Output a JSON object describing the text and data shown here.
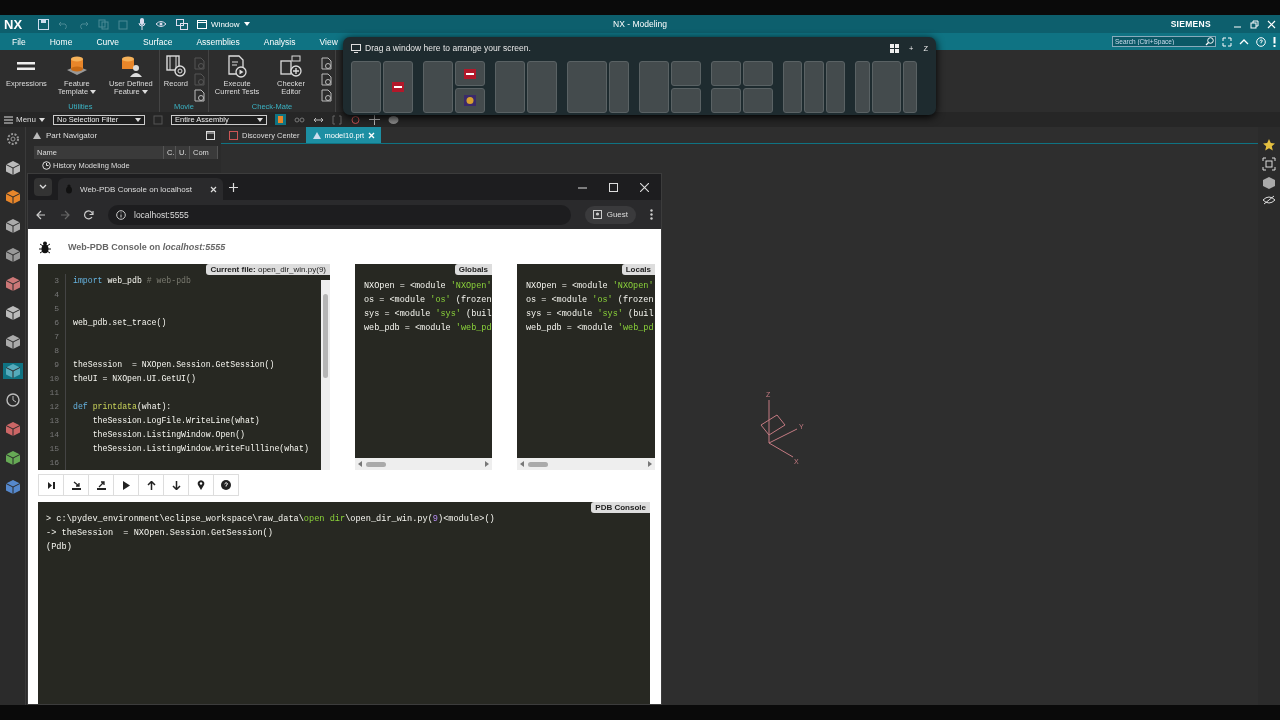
{
  "nx": {
    "logo": "NX",
    "window_menu": "Window",
    "title": "NX - Modeling",
    "brand": "SIEMENS",
    "menu_tabs": [
      {
        "label": "File",
        "selected": false
      },
      {
        "label": "Home",
        "selected": false
      },
      {
        "label": "Curve",
        "selected": false
      },
      {
        "label": "Surface",
        "selected": false
      },
      {
        "label": "Assemblies",
        "selected": false
      },
      {
        "label": "Analysis",
        "selected": false
      },
      {
        "label": "View",
        "selected": false
      }
    ],
    "search": {
      "placeholder": "Search (Ctrl+Space)"
    },
    "ribbon": [
      {
        "label": "Utilities",
        "tools": [
          {
            "label": "Expressions",
            "kind": "equals",
            "has_menu": false
          },
          {
            "label": "Feature Template",
            "kind": "template",
            "has_menu": true
          },
          {
            "label": "User Defined Feature",
            "kind": "udf",
            "has_menu": true
          }
        ]
      },
      {
        "label": "Movie",
        "tools": [
          {
            "label": "Record",
            "kind": "film",
            "has_menu": false
          }
        ]
      },
      {
        "label": "Check-Mate",
        "tools": [
          {
            "label": "Execute Current Tests",
            "kind": "run",
            "has_menu": false
          },
          {
            "label": "Checker Editor",
            "kind": "checker",
            "has_menu": false
          }
        ]
      }
    ],
    "toolbar": {
      "menu": "Menu",
      "selection_filter": "No Selection Filter",
      "assembly_scope": "Entire Assembly"
    },
    "resource_bar": [
      {
        "selected": false
      },
      {
        "selected": false
      },
      {
        "selected": false
      },
      {
        "selected": false
      },
      {
        "selected": false
      },
      {
        "selected": false
      },
      {
        "selected": false
      },
      {
        "selected": false
      },
      {
        "selected": true
      },
      {
        "selected": false
      },
      {
        "selected": false
      },
      {
        "selected": false
      },
      {
        "selected": false
      }
    ],
    "navigator": {
      "title": "Part Navigator",
      "columns": [
        "Name",
        "C.",
        "U.",
        "Com"
      ],
      "rows": [
        {
          "label": "History Modeling Mode"
        }
      ]
    },
    "doc_tabs": [
      {
        "label": "Discovery Center",
        "selected": false
      },
      {
        "label": "model10.prt",
        "selected": true
      }
    ],
    "triad_labels": [
      "Z",
      "Y",
      "X"
    ]
  },
  "snap_assist": {
    "hint": "Drag a window here to arrange your screen.",
    "keys": [
      "+",
      "Z"
    ]
  },
  "browser": {
    "tab": {
      "title": "Web-PDB Console on localhost"
    },
    "address": "localhost:5555",
    "profile": "Guest",
    "page": {
      "heading": "Web-PDB Console on *localhost:5555*",
      "current_file": "**Current file:** open_dir_win.py(9)",
      "code": [
        {
          "number": "3",
          "tokens": [
            {
              "text": "import",
              "kind": "keyword"
            },
            {
              "text": " web_pdb ",
              "kind": "plain"
            },
            {
              "text": "# web-pdb",
              "kind": "comment"
            }
          ]
        },
        {
          "number": "4"
        },
        {
          "number": "5"
        },
        {
          "number": "6",
          "tokens": [
            {
              "text": "web_pdb.set_trace()",
              "kind": "plain"
            }
          ]
        },
        {
          "number": "7"
        },
        {
          "number": "8"
        },
        {
          "number": "9",
          "tokens": [
            {
              "text": "theSession  = NXOpen.Session.GetSession()",
              "kind": "plain"
            }
          ]
        },
        {
          "number": "10",
          "tokens": [
            {
              "text": "theUI = NXOpen.UI.GetUI()",
              "kind": "plain"
            }
          ]
        },
        {
          "number": "11"
        },
        {
          "number": "12",
          "tokens": [
            {
              "text": "def ",
              "kind": "keyword"
            },
            {
              "text": "printdata",
              "kind": "func"
            },
            {
              "text": "(what):",
              "kind": "plain"
            }
          ]
        },
        {
          "number": "13",
          "tokens": [
            {
              "text": "    theSession.LogFile.WriteLine(what)",
              "kind": "plain"
            }
          ]
        },
        {
          "number": "14",
          "tokens": [
            {
              "text": "    theSession.ListingWindow.Open()",
              "kind": "plain"
            }
          ]
        },
        {
          "number": "15",
          "tokens": [
            {
              "text": "    theSession.ListingWindow.WriteFullline(what)",
              "kind": "plain"
            }
          ]
        },
        {
          "number": "16"
        }
      ],
      "globals": {
        "label": "Globals",
        "lines": [
          [
            {
              "text": "NXOpen = <module ",
              "kind": "plain"
            },
            {
              "text": "'NXOpen'",
              "kind": "string"
            }
          ],
          [
            {
              "text": "os = <module ",
              "kind": "plain"
            },
            {
              "text": "'os'",
              "kind": "string"
            },
            {
              "text": " (frozen",
              "kind": "plain"
            }
          ],
          [
            {
              "text": "sys = <module ",
              "kind": "plain"
            },
            {
              "text": "'sys'",
              "kind": "string"
            },
            {
              "text": " (buil",
              "kind": "plain"
            }
          ],
          [
            {
              "text": "web_pdb = <module ",
              "kind": "plain"
            },
            {
              "text": "'web_pd",
              "kind": "string"
            }
          ]
        ]
      },
      "locals": {
        "label": "Locals",
        "lines": [
          [
            {
              "text": "NXOpen = <module ",
              "kind": "plain"
            },
            {
              "text": "'NXOpen'",
              "kind": "string"
            }
          ],
          [
            {
              "text": "os = <module ",
              "kind": "plain"
            },
            {
              "text": "'os'",
              "kind": "string"
            },
            {
              "text": " (frozen",
              "kind": "plain"
            }
          ],
          [
            {
              "text": "sys = <module ",
              "kind": "plain"
            },
            {
              "text": "'sys'",
              "kind": "string"
            },
            {
              "text": " (buil",
              "kind": "plain"
            }
          ],
          [
            {
              "text": "web_pdb = <module ",
              "kind": "plain"
            },
            {
              "text": "'web_pd",
              "kind": "string"
            }
          ]
        ]
      },
      "console": {
        "label": "PDB Console",
        "lines": [
          [
            {
              "text": "> c:\\pydev_environment\\eclipse_workspace\\raw_data\\",
              "kind": "plain"
            },
            {
              "text": "open dir",
              "kind": "string"
            },
            {
              "text": "\\open_dir_win.py(",
              "kind": "plain"
            },
            {
              "text": "9",
              "kind": "number"
            },
            {
              "text": ")<module>()",
              "kind": "plain"
            }
          ],
          [
            {
              "text": "-> theSession  = NXOpen.Session.GetSession()",
              "kind": "plain"
            }
          ],
          [
            {
              "text": "(Pdb)",
              "kind": "plain"
            }
          ]
        ]
      }
    }
  }
}
